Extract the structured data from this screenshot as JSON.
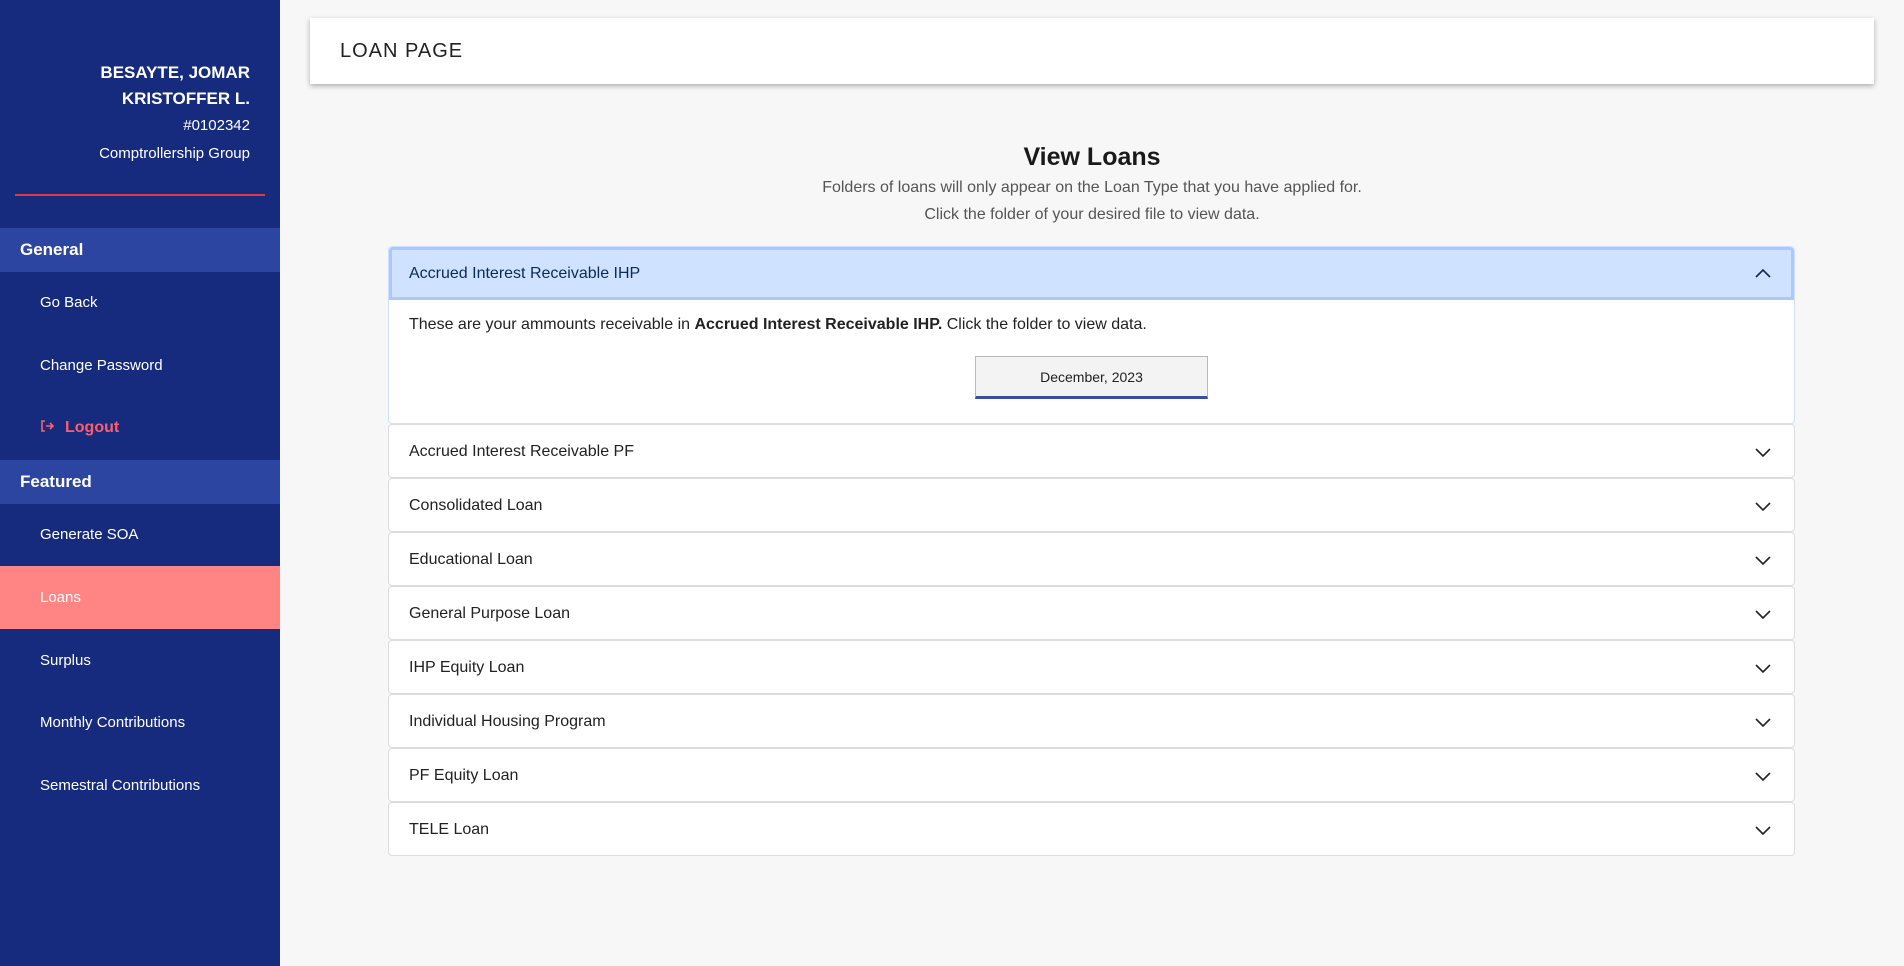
{
  "user": {
    "name_line1": "BESAYTE, JOMAR",
    "name_line2": "KRISTOFFER L.",
    "id": "#0102342",
    "group": "Comptrollership Group"
  },
  "sidebar": {
    "general_label": "General",
    "featured_label": "Featured",
    "general_items": [
      {
        "label": "Go Back"
      },
      {
        "label": "Change Password"
      },
      {
        "label": "Logout"
      }
    ],
    "featured_items": [
      {
        "label": "Generate SOA"
      },
      {
        "label": "Loans"
      },
      {
        "label": "Surplus"
      },
      {
        "label": "Monthly Contributions"
      },
      {
        "label": "Semestral Contributions"
      }
    ]
  },
  "header": {
    "title": "LOAN PAGE"
  },
  "main": {
    "title": "View Loans",
    "subtitle1": "Folders of loans will only appear on the Loan Type that you have applied for.",
    "subtitle2": "Click the folder of your desired file to view data."
  },
  "accordion": {
    "open": {
      "label": "Accrued Interest Receivable IHP",
      "body_prefix": "These are your ammounts receivable in ",
      "body_bold": "Accrued Interest Receivable IHP.",
      "body_suffix": " Click the folder to view data.",
      "folder_label": "December, 2023"
    },
    "items": [
      {
        "label": "Accrued Interest Receivable PF"
      },
      {
        "label": "Consolidated Loan"
      },
      {
        "label": "Educational Loan"
      },
      {
        "label": "General Purpose Loan"
      },
      {
        "label": "IHP Equity Loan"
      },
      {
        "label": "Individual Housing Program"
      },
      {
        "label": "PF Equity Loan"
      },
      {
        "label": "TELE Loan"
      }
    ]
  },
  "colors": {
    "sidebar_bg": "#172b7e",
    "section_bg": "#2c45a0",
    "active_bg": "#ff8585",
    "logout": "#ff5d6e",
    "open_header": "#cfe2ff"
  }
}
